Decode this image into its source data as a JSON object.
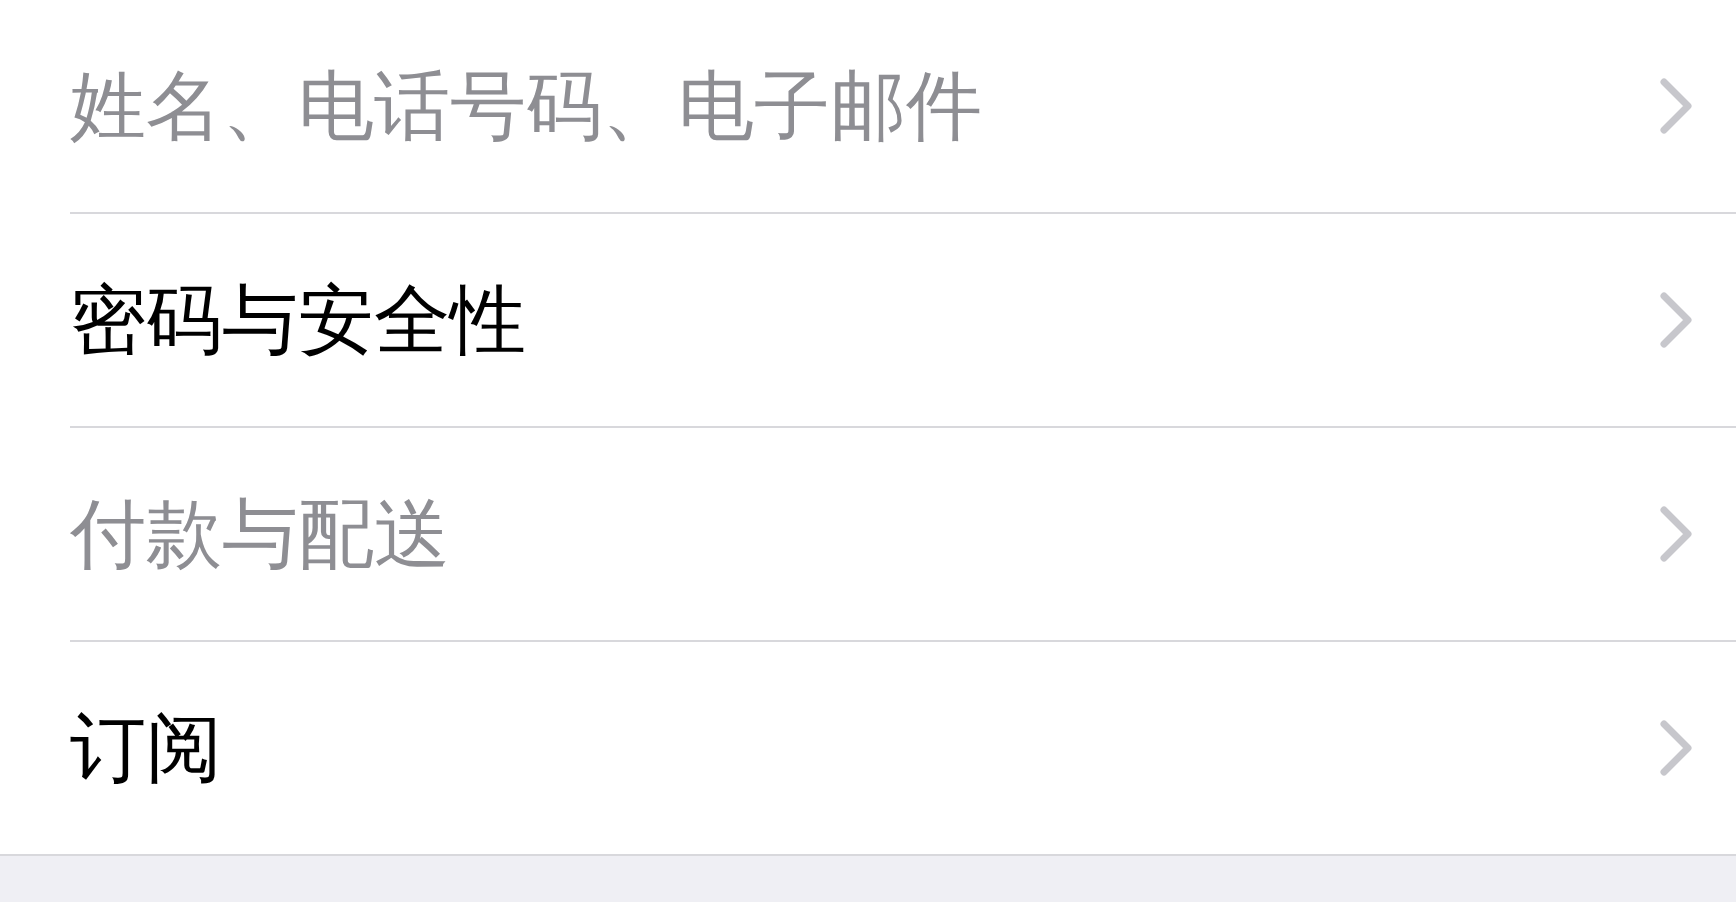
{
  "settings_list": [
    {
      "label": "姓名、电话号码、电子邮件",
      "disabled": true
    },
    {
      "label": "密码与安全性",
      "disabled": false
    },
    {
      "label": "付款与配送",
      "disabled": true
    },
    {
      "label": "订阅",
      "disabled": false
    }
  ]
}
